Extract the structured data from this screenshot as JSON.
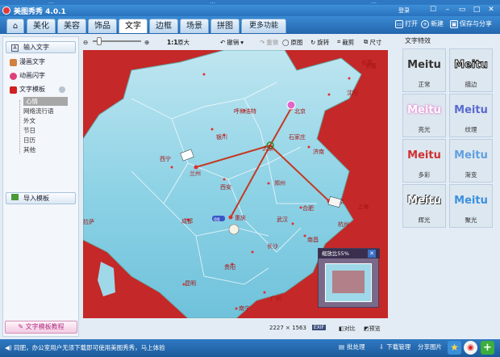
{
  "external_bar": [
    "…",
    "…",
    "…"
  ],
  "window": {
    "title": "美图秀秀 4.0.1",
    "login": "登录",
    "controls": [
      "minimize",
      "restore",
      "maximize",
      "close"
    ]
  },
  "menu_tabs": [
    {
      "label": "美化"
    },
    {
      "label": "美容"
    },
    {
      "label": "饰品"
    },
    {
      "label": "文字",
      "active": true
    },
    {
      "label": "边框"
    },
    {
      "label": "场景"
    },
    {
      "label": "拼图"
    },
    {
      "label": "更多功能"
    }
  ],
  "menu_right": {
    "open": "打开",
    "new": "新建",
    "save_share": "保存与分享"
  },
  "sidebar": {
    "input_text": "输入文字",
    "items": [
      {
        "label": "漫画文字",
        "icon": "comic-icon",
        "color": "#d08040"
      },
      {
        "label": "动画闪字",
        "icon": "heart-icon",
        "color": "#e0407a"
      },
      {
        "label": "文字模板",
        "icon": "template-icon",
        "color": "#d02020"
      }
    ],
    "template_sub": [
      "心情",
      "网络流行语",
      "外文",
      "节日",
      "日历",
      "其他"
    ],
    "selected_sub": "心情",
    "import_template": "导入模板",
    "tutorial": "文字模板教程"
  },
  "toolbar": {
    "zoom_label": "1:1",
    "original_size": "原大",
    "undo": "撤销",
    "redo": "重做",
    "original_image": "原图",
    "rotate": "旋转",
    "crop": "裁剪",
    "resize": "尺寸"
  },
  "map": {
    "cities": [
      "长春",
      "长春",
      "沈阳",
      "呼和浩特",
      "北京",
      "太原",
      "石家庄",
      "西宁",
      "银川",
      "济南",
      "兰州",
      "西安",
      "郑州",
      "合肥",
      "南京",
      "上海",
      "成都",
      "重庆",
      "武汉",
      "杭州",
      "贵阳",
      "长沙",
      "南昌",
      "昆明",
      "广州",
      "南宁",
      "福州",
      "拉萨"
    ],
    "sticker_text": "qq",
    "overview_zoom": "缩放比55%"
  },
  "status": {
    "dimensions": "2227 × 1563",
    "exif": "EXIF",
    "compare": "对比",
    "preview": "预览"
  },
  "effects": {
    "header": "文字特效",
    "items": [
      {
        "art": "Meitu",
        "label": "正常",
        "color": "#333333",
        "stroke": ""
      },
      {
        "art": "Meitu",
        "label": "描边",
        "color": "#ffffff",
        "stroke": "#111111"
      },
      {
        "art": "Meitu",
        "label": "亮光",
        "color": "#ffffff",
        "stroke": "#e080d0"
      },
      {
        "art": "Meitu",
        "label": "纹理",
        "color": "#5a6ad0",
        "stroke": ""
      },
      {
        "art": "Meitu",
        "label": "多彩",
        "color": "#d03030",
        "stroke": ""
      },
      {
        "art": "Meitu",
        "label": "渐变",
        "color": "#60a0e0",
        "stroke": ""
      },
      {
        "art": "Meitu",
        "label": "辉光",
        "color": "#ffffff",
        "stroke": "#333333"
      },
      {
        "art": "Meitu",
        "label": "聚光",
        "color": "#3a90e0",
        "stroke": ""
      }
    ]
  },
  "bottombar": {
    "message": "同肥，办公室用户无须下载即可使用美图秀秀，马上体验",
    "batch": "批处理",
    "download": "下载管理",
    "share_image": "分享图片"
  }
}
